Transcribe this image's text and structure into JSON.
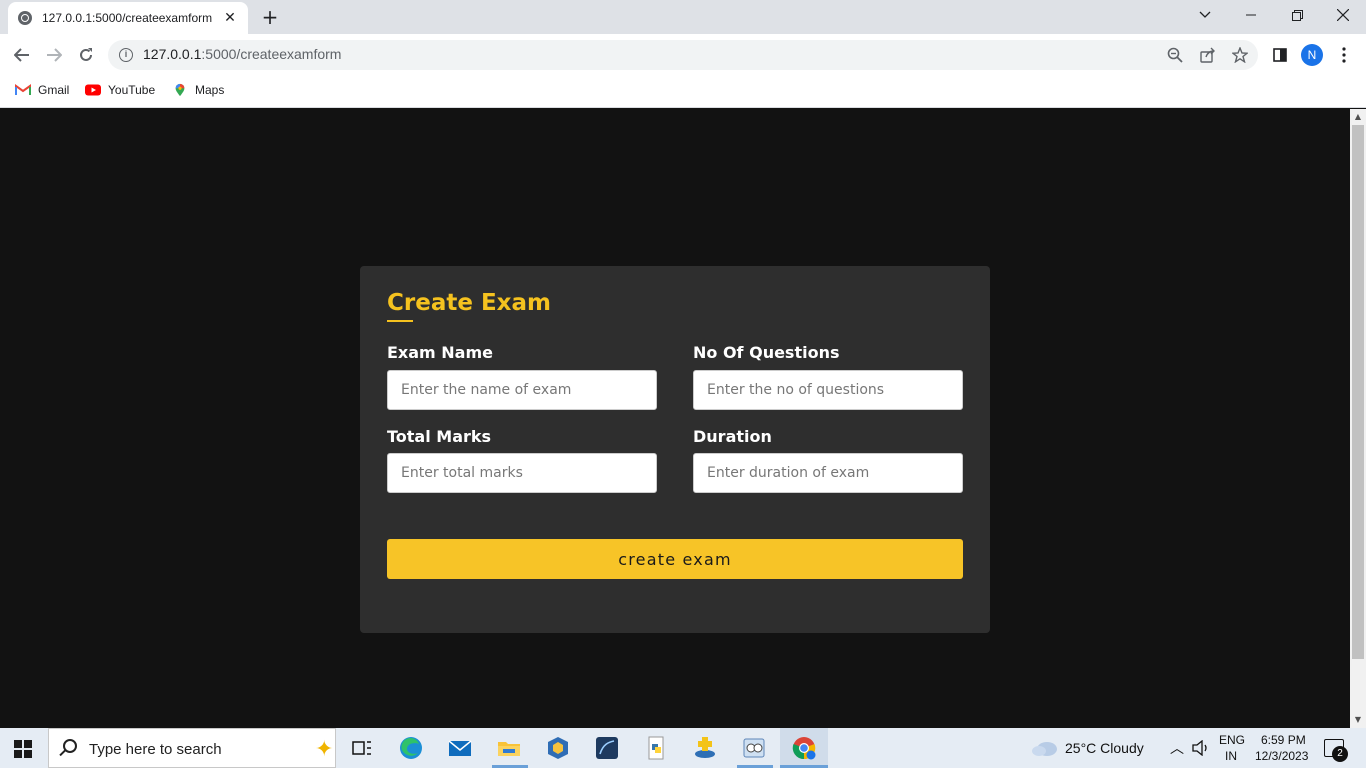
{
  "browser": {
    "tab_title": "127.0.0.1:5000/createexamform",
    "tab_close": "✕",
    "new_tab": "+",
    "url_host": "127.0.0.1",
    "url_rest": ":5000/createexamform",
    "profile_initial": "N",
    "bookmarks": [
      {
        "label": "Gmail",
        "icon": "gmail-icon"
      },
      {
        "label": "YouTube",
        "icon": "youtube-icon"
      },
      {
        "label": "Maps",
        "icon": "maps-icon"
      }
    ]
  },
  "form": {
    "title": "Create Exam",
    "exam_name_label": "Exam Name",
    "exam_name_placeholder": "Enter the name of exam",
    "no_of_questions_label": "No Of Questions",
    "no_of_questions_placeholder": "Enter the no of questions",
    "total_marks_label": "Total Marks",
    "total_marks_placeholder": "Enter total marks",
    "duration_label": "Duration",
    "duration_placeholder": "Enter duration of exam",
    "submit_label": "create exam",
    "accent_color": "#f5c21f",
    "card_color": "#2e2e2e",
    "page_bg": "#121212"
  },
  "taskbar": {
    "search_placeholder": "Type here to search",
    "weather": "25°C  Cloudy",
    "lang_top": "ENG",
    "lang_bottom": "IN",
    "time": "6:59 PM",
    "date": "12/3/2023",
    "notification_count": "2"
  }
}
